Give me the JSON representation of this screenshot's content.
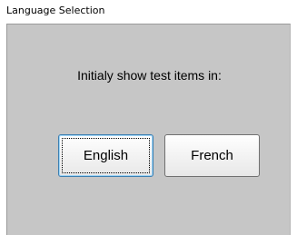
{
  "window": {
    "title": "Language Selection"
  },
  "dialog": {
    "prompt": "Initialy show test items in:",
    "buttons": [
      {
        "label": "English",
        "default": true
      },
      {
        "label": "French",
        "default": false
      }
    ]
  }
}
